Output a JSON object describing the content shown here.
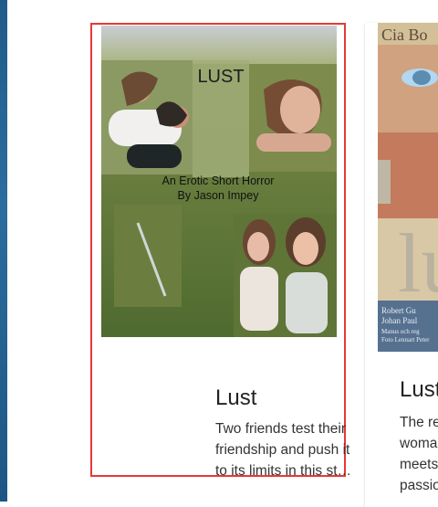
{
  "cards": [
    {
      "title": "Lust",
      "description": "Two friends test their\nfriendship and push it\nto its limits in this st…",
      "cover": {
        "title": "LUST",
        "subtitle": "An Erotic Short Horror",
        "author": "By Jason Impey"
      },
      "add_label": "+"
    },
    {
      "title": "Lust",
      "description": "The re\nwoma\nmeets\npassio",
      "cover": {
        "top_text": "Cia Bo",
        "big_text": "lu",
        "bottom_line_1": "Robert Gu",
        "bottom_line_2": "Johan Paul",
        "bottom_line_3": "Manus och reg",
        "bottom_line_4": "Foto Lennart Peter"
      }
    }
  ],
  "colors": {
    "selected_border": "#e53935",
    "fab": "#f44336",
    "left_strip": "#1f5b8a"
  },
  "icons": {
    "add": "plus-icon",
    "more": "more-vertical-icon"
  }
}
